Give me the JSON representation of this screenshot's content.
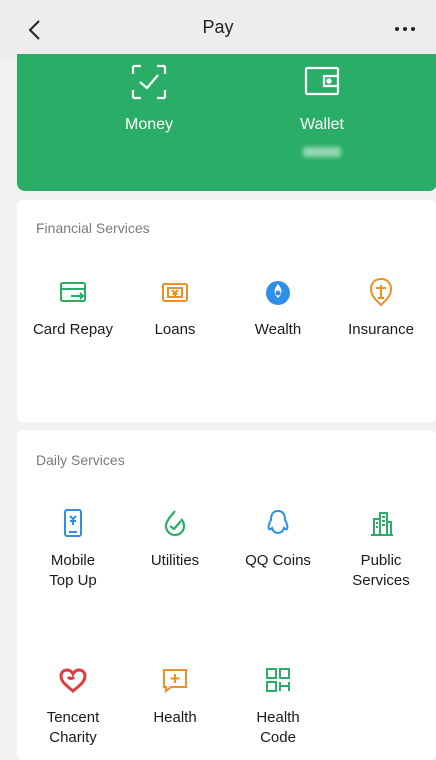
{
  "nav": {
    "title": "Pay",
    "back_icon": "back-chevron-icon",
    "more_icon": "more-dots-icon"
  },
  "banner": {
    "color": "#2aae67",
    "money_label": "Money",
    "wallet_label": "Wallet"
  },
  "financial": {
    "heading": "Financial Services",
    "items": [
      {
        "label": "Card Repay",
        "icon": "card-repay-icon"
      },
      {
        "label": "Loans",
        "icon": "loans-icon"
      },
      {
        "label": "Wealth",
        "icon": "wealth-icon"
      },
      {
        "label": "Insurance",
        "icon": "insurance-icon"
      }
    ]
  },
  "daily": {
    "heading": "Daily Services",
    "items": [
      {
        "label": "Mobile\nTop Up",
        "icon": "mobile-top-up-icon"
      },
      {
        "label": "Utilities",
        "icon": "utilities-icon"
      },
      {
        "label": "QQ Coins",
        "icon": "qq-coins-icon"
      },
      {
        "label": "Public\nServices",
        "icon": "public-services-icon"
      },
      {
        "label": "Tencent\nCharity",
        "icon": "tencent-charity-icon"
      },
      {
        "label": "Health",
        "icon": "health-icon"
      },
      {
        "label": "Health\nCode",
        "icon": "health-code-icon"
      }
    ]
  }
}
